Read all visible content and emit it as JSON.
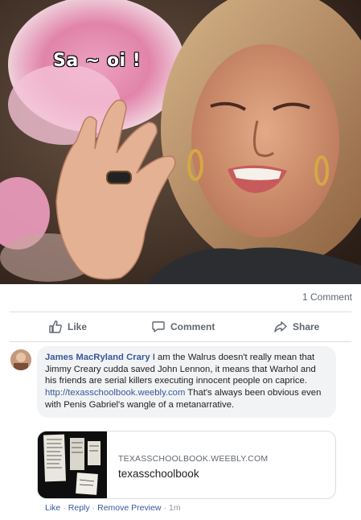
{
  "photo": {
    "caption": "Sa ~ oi !"
  },
  "post": {
    "comment_count": "1 Comment"
  },
  "actions": {
    "like": "Like",
    "comment": "Comment",
    "share": "Share"
  },
  "comment": {
    "author": "James MacRyland Crary",
    "text_before_link": " I am the Walrus doesn't really mean that Jimmy Creary cudda saved John Lennon, it means that Warhol and his friends are serial killers executing innocent people on caprice. ",
    "link": "http://texasschoolbook.weebly.com",
    "text_after_link": " That's always been obvious even with Penis Gabriel's wangle of a metanarrative.",
    "preview": {
      "domain": "TEXASSCHOOLBOOK.WEEBLY.COM",
      "title": "texasschoolbook"
    },
    "meta": {
      "like": "Like",
      "reply": "Reply",
      "remove_preview": "Remove Preview",
      "sep": "·",
      "time": "1m"
    }
  },
  "colors": {
    "link": "#385898",
    "muted": "#606770",
    "bubble": "#f2f3f5",
    "divider": "#dadde1"
  },
  "icons": [
    "like-icon",
    "comment-icon",
    "share-icon"
  ]
}
